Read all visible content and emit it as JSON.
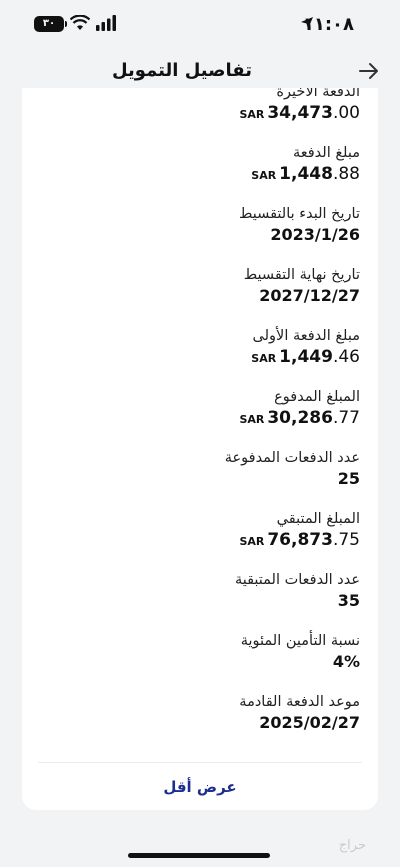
{
  "status_bar": {
    "time": "١١:٠٨",
    "battery": "٣٠"
  },
  "header": {
    "title": "تفاصيل التمويل"
  },
  "items": [
    {
      "label": "الدفعة الأخيرة",
      "currency": "SAR",
      "int": "34,473",
      "dec": ".00"
    },
    {
      "label": "مبلغ الدفعة",
      "currency": "SAR",
      "int": "1,448",
      "dec": ".88"
    },
    {
      "label": "تاريخ البدء بالتقسيط",
      "value": "2023/1/26"
    },
    {
      "label": "تاريخ نهاية التقسيط",
      "value": "2027/12/27"
    },
    {
      "label": "مبلغ الدفعة الأولى",
      "currency": "SAR",
      "int": "1,449",
      "dec": ".46"
    },
    {
      "label": "المبلغ المدفوع",
      "currency": "SAR",
      "int": "30,286",
      "dec": ".77"
    },
    {
      "label": "عدد الدفعات المدفوعة",
      "value": "25"
    },
    {
      "label": "المبلغ المتبقي",
      "currency": "SAR",
      "int": "76,873",
      "dec": ".75"
    },
    {
      "label": "عدد الدفعات المتبقية",
      "value": "35"
    },
    {
      "label": "نسبة التأمين المئوية",
      "value": "4%"
    },
    {
      "label": "موعد الدفعة القادمة",
      "value": "2025/02/27"
    }
  ],
  "show_less": "عرض أقل",
  "watermark": "حراج",
  "colors": {
    "link": "#1d2e93",
    "background": "#f2f3f5",
    "card": "#ffffff"
  }
}
